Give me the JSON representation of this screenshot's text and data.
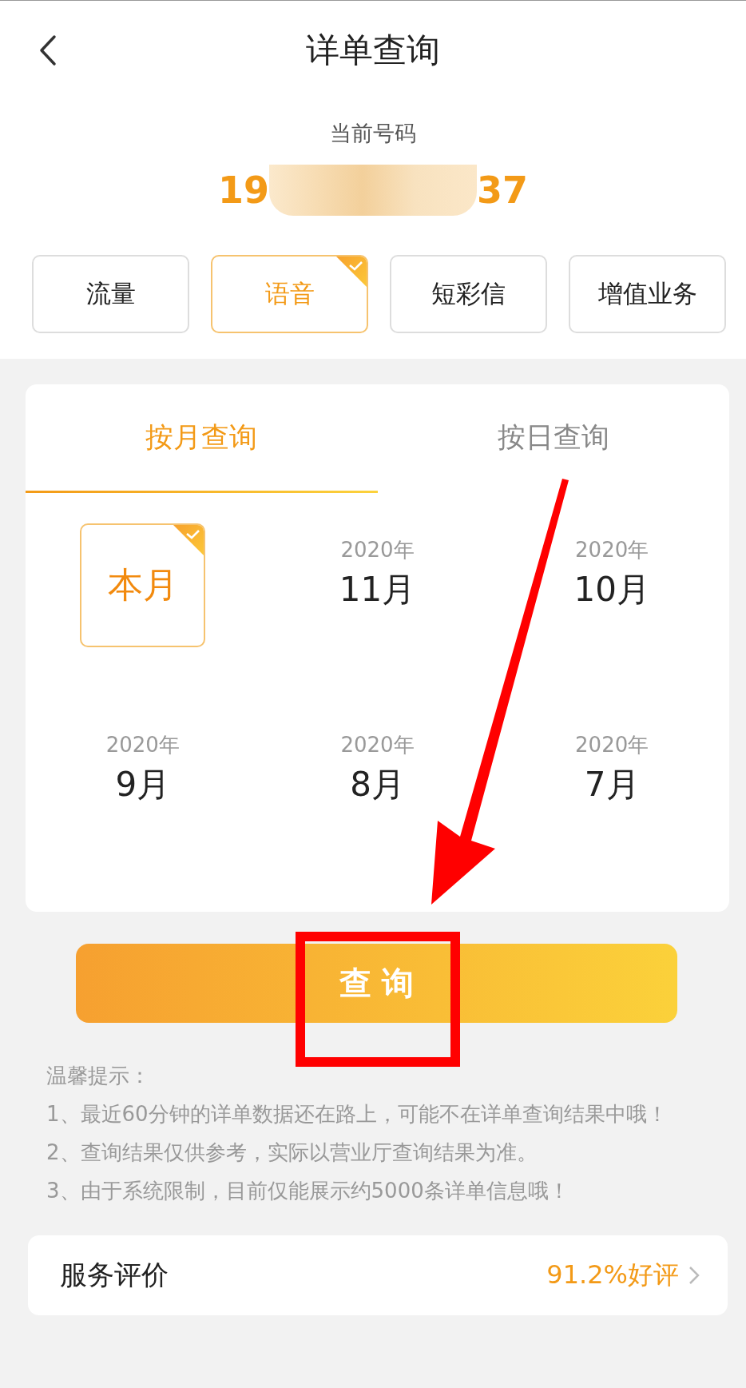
{
  "header": {
    "title": "详单查询"
  },
  "current_number": {
    "label": "当前号码",
    "start": "19",
    "end": "37"
  },
  "categories": [
    {
      "label": "流量",
      "selected": false
    },
    {
      "label": "语音",
      "selected": true
    },
    {
      "label": "短彩信",
      "selected": false
    },
    {
      "label": "增值业务",
      "selected": false
    }
  ],
  "query_tabs": [
    {
      "label": "按月查询",
      "selected": true
    },
    {
      "label": "按日查询",
      "selected": false
    }
  ],
  "months": [
    {
      "kind": "current",
      "label": "本月",
      "selected": true
    },
    {
      "kind": "month",
      "year": "2020年",
      "month": "11月",
      "selected": false
    },
    {
      "kind": "month",
      "year": "2020年",
      "month": "10月",
      "selected": false
    },
    {
      "kind": "month",
      "year": "2020年",
      "month": "9月",
      "selected": false
    },
    {
      "kind": "month",
      "year": "2020年",
      "month": "8月",
      "selected": false
    },
    {
      "kind": "month",
      "year": "2020年",
      "month": "7月",
      "selected": false
    }
  ],
  "query_button": "查 询",
  "tips": {
    "title": "温馨提示：",
    "lines": [
      "1、最近60分钟的详单数据还在路上，可能不在详单查询结果中哦！",
      "2、查询结果仅供参考，实际以营业厅查询结果为准。",
      "3、由于系统限制，目前仅能展示约5000条详单信息哦！"
    ]
  },
  "service_rating": {
    "label": "服务评价",
    "value": "91.2%好评"
  }
}
